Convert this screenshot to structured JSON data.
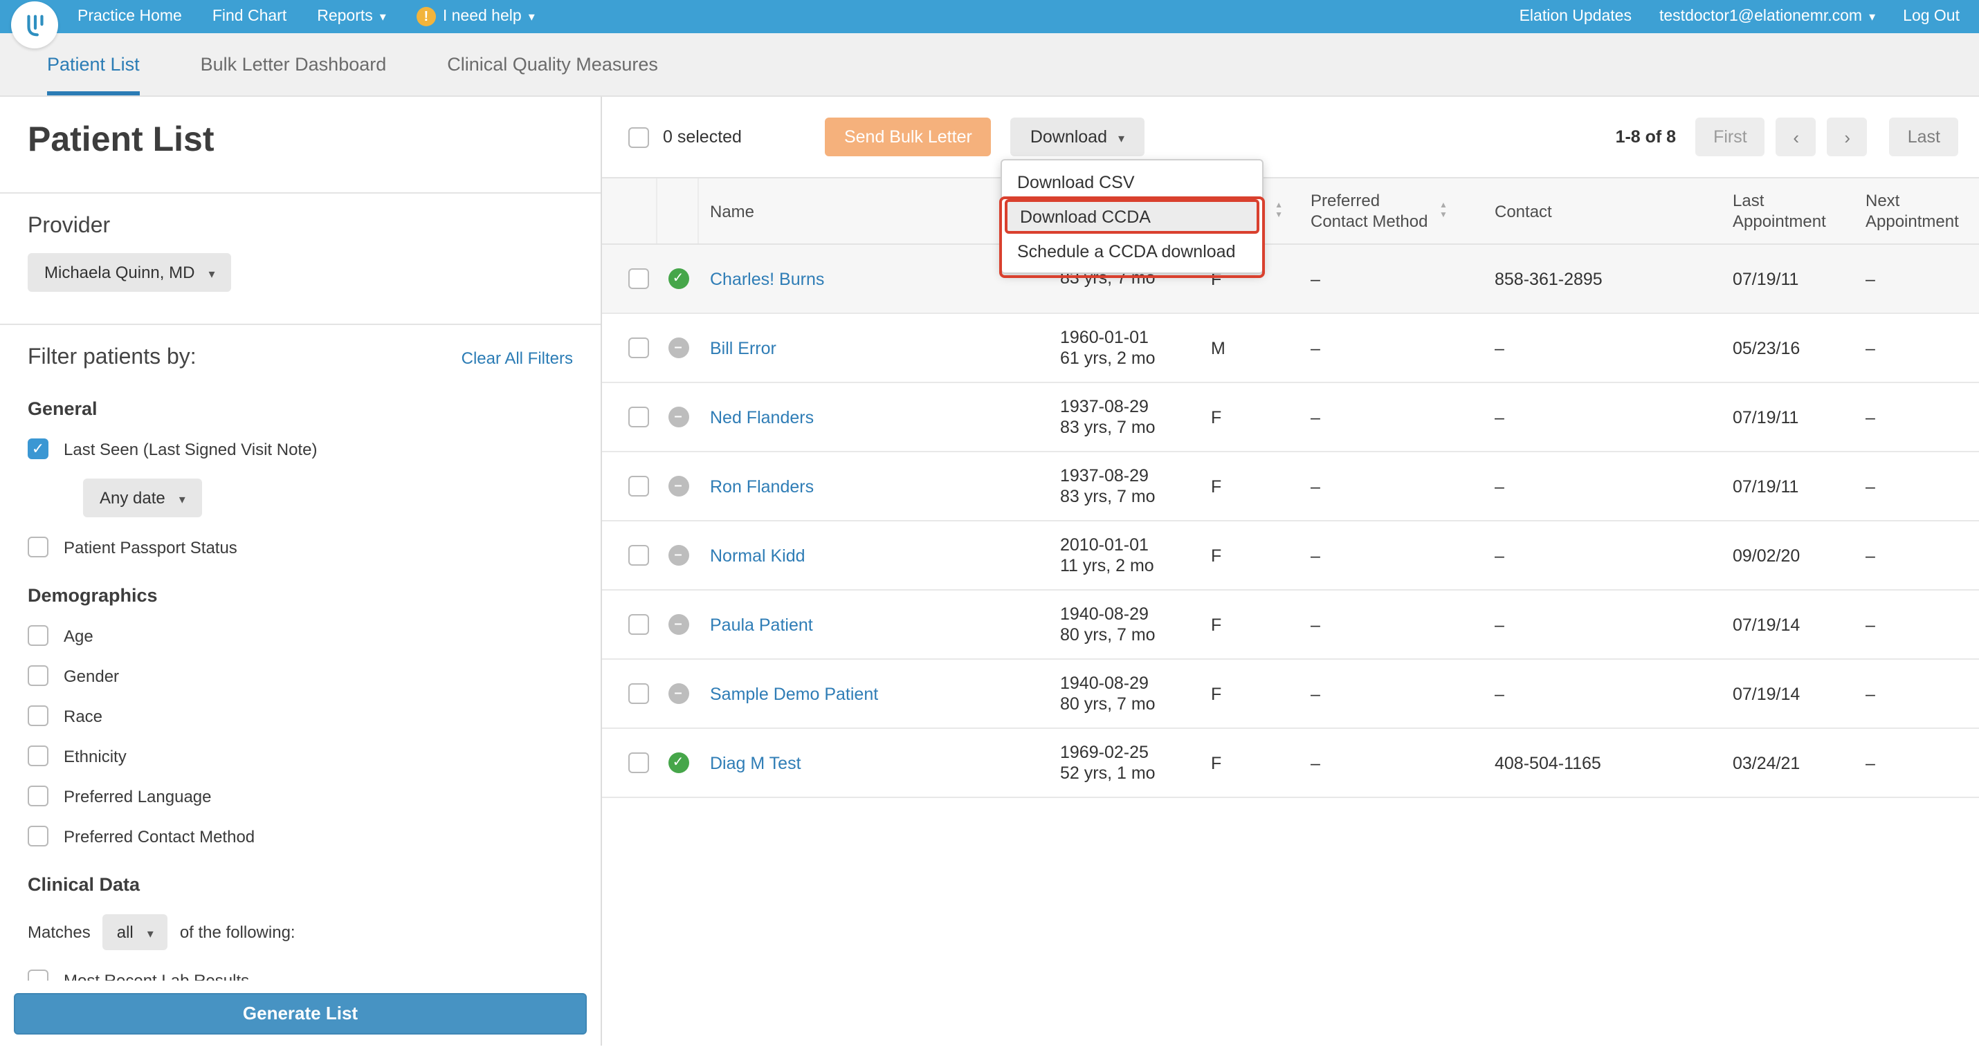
{
  "colors": {
    "navbar_bg": "#3da0d4",
    "accent_blue": "#2b7cb5",
    "link_blue": "#2f7db6",
    "annotation_red": "#d9402e",
    "success_green": "#46a64a",
    "neutral_icon_gray": "#bdbdbd",
    "send_button_orange": "#f5b17c",
    "generate_button_blue": "#4793c3"
  },
  "navbar": {
    "practice_home": "Practice Home",
    "find_chart": "Find Chart",
    "reports": "Reports",
    "need_help": "I need help",
    "elation_updates": "Elation Updates",
    "account_email": "testdoctor1@elationemr.com",
    "log_out": "Log Out"
  },
  "tabs": {
    "patient_list": "Patient List",
    "bulk_letter": "Bulk Letter Dashboard",
    "cqm": "Clinical Quality Measures"
  },
  "sidebar": {
    "title": "Patient List",
    "provider": {
      "label": "Provider",
      "selected": "Michaela Quinn, MD"
    },
    "filters": {
      "heading": "Filter patients by:",
      "clear_all": "Clear All Filters",
      "general": {
        "heading": "General",
        "last_seen": {
          "label": "Last Seen (Last Signed Visit Note)",
          "checked": true,
          "date_range": "Any date"
        },
        "passport": {
          "label": "Patient Passport Status",
          "checked": false
        }
      },
      "demographics": {
        "heading": "Demographics",
        "items": [
          "Age",
          "Gender",
          "Race",
          "Ethnicity",
          "Preferred Language",
          "Preferred Contact Method"
        ]
      },
      "clinical": {
        "heading": "Clinical Data",
        "matches_prefix": "Matches",
        "matches_value": "all",
        "matches_suffix": "of the following:",
        "first_item": "Most Recent Lab Results"
      }
    },
    "generate_button": "Generate List"
  },
  "toolbar": {
    "selected_count": "0 selected",
    "send_bulk_letter": "Send Bulk Letter",
    "download": "Download",
    "pagination": {
      "range": "1-8 of 8",
      "first": "First",
      "last": "Last"
    }
  },
  "download_menu": {
    "items": [
      "Download CSV",
      "Download CCDA",
      "Schedule a CCDA download"
    ],
    "annotated_item": "Download CCDA"
  },
  "table": {
    "headers": {
      "name": "Name",
      "preferred_contact": "Preferred Contact Method",
      "contact": "Contact",
      "last_appointment": "Last Appointment",
      "next_appointment": "Next Appointment"
    },
    "rows": [
      {
        "status": "green-check",
        "name": "Charles! Burns",
        "dob": "",
        "age": "83 yrs, 7 mo",
        "sex": "F",
        "preferred_contact": "–",
        "contact": "858-361-2895",
        "last_appointment": "07/19/11",
        "next_appointment": "–"
      },
      {
        "status": "gray-minus",
        "name": "Bill Error",
        "dob": "1960-01-01",
        "age": "61 yrs, 2 mo",
        "sex": "M",
        "preferred_contact": "–",
        "contact": "–",
        "last_appointment": "05/23/16",
        "next_appointment": "–"
      },
      {
        "status": "gray-minus",
        "name": "Ned Flanders",
        "dob": "1937-08-29",
        "age": "83 yrs, 7 mo",
        "sex": "F",
        "preferred_contact": "–",
        "contact": "–",
        "last_appointment": "07/19/11",
        "next_appointment": "–"
      },
      {
        "status": "gray-minus",
        "name": "Ron Flanders",
        "dob": "1937-08-29",
        "age": "83 yrs, 7 mo",
        "sex": "F",
        "preferred_contact": "–",
        "contact": "–",
        "last_appointment": "07/19/11",
        "next_appointment": "–"
      },
      {
        "status": "gray-minus",
        "name": "Normal Kidd",
        "dob": "2010-01-01",
        "age": "11 yrs, 2 mo",
        "sex": "F",
        "preferred_contact": "–",
        "contact": "–",
        "last_appointment": "09/02/20",
        "next_appointment": "–"
      },
      {
        "status": "gray-minus",
        "name": "Paula Patient",
        "dob": "1940-08-29",
        "age": "80 yrs, 7 mo",
        "sex": "F",
        "preferred_contact": "–",
        "contact": "–",
        "last_appointment": "07/19/14",
        "next_appointment": "–"
      },
      {
        "status": "gray-minus",
        "name": "Sample Demo Patient",
        "dob": "1940-08-29",
        "age": "80 yrs, 7 mo",
        "sex": "F",
        "preferred_contact": "–",
        "contact": "–",
        "last_appointment": "07/19/14",
        "next_appointment": "–"
      },
      {
        "status": "green-check",
        "name": "Diag M Test",
        "dob": "1969-02-25",
        "age": "52 yrs, 1 mo",
        "sex": "F",
        "preferred_contact": "–",
        "contact": "408-504-1165",
        "last_appointment": "03/24/21",
        "next_appointment": "–"
      }
    ]
  }
}
